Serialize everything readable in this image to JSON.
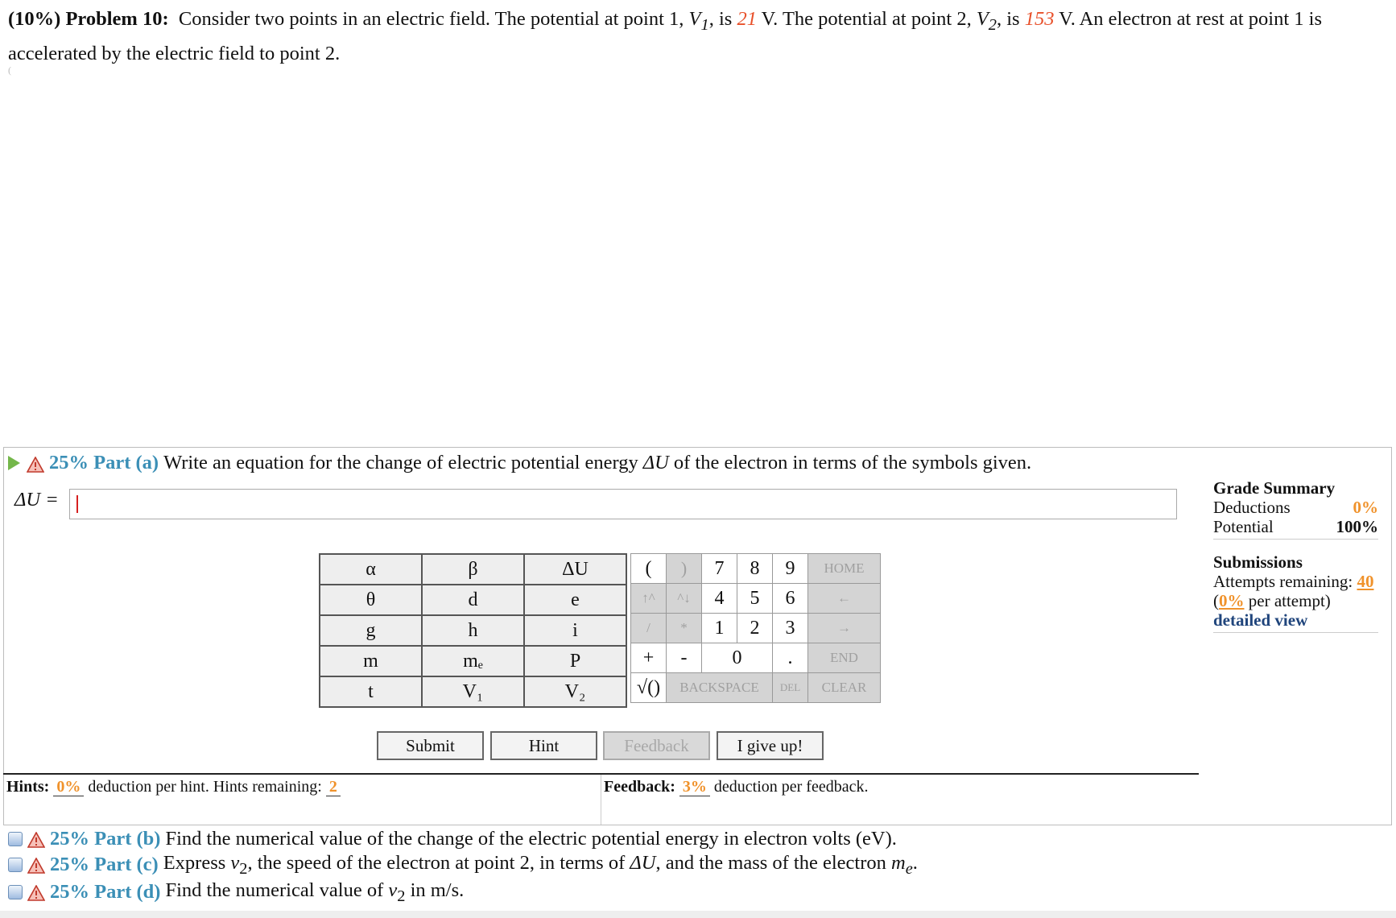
{
  "problem": {
    "weight": "(10%)",
    "title": "Problem 10:",
    "text1": "Consider two points in an electric field. The potential at point 1,",
    "v1_sym": "V",
    "v1_sub": "1",
    "is1": ", is",
    "v1_val": "21",
    "text2": "V. The potential at point 2,",
    "v2_sym": "V",
    "v2_sub": "2",
    "is2": ", is",
    "v2_val": "153",
    "text3": "V. An electron at rest at point 1 is accelerated by the electric field to point 2."
  },
  "part_a": {
    "pct": "25% Part (a)",
    "text": "Write an equation for the change of electric potential energy",
    "sym": "ΔU",
    "text2": "of the electron in terms of the symbols given.",
    "answer_label": "ΔU =",
    "answer_value": ""
  },
  "grade": {
    "title": "Grade Summary",
    "deductions_label": "Deductions",
    "deductions_value": "0%",
    "potential_label": "Potential",
    "potential_value": "100%",
    "submissions_title": "Submissions",
    "attempts_label": "Attempts remaining:",
    "attempts_value": "40",
    "per_attempt_open": "(",
    "per_attempt_value": "0%",
    "per_attempt_close": "per attempt)",
    "detailed": "detailed view"
  },
  "symbols": [
    [
      "α",
      "β",
      "ΔU"
    ],
    [
      "θ",
      "d",
      "e"
    ],
    [
      "g",
      "h",
      "i"
    ],
    [
      "m",
      "mₑ",
      "P"
    ],
    [
      "t",
      "V₁",
      "V₂"
    ]
  ],
  "keypad": {
    "open_paren": "(",
    "close_paren": ")",
    "k7": "7",
    "k8": "8",
    "k9": "9",
    "home": "HOME",
    "up_caret": "↑^",
    "down_caret": "^↓",
    "k4": "4",
    "k5": "5",
    "k6": "6",
    "left": "←",
    "divide": "/",
    "multiply": "*",
    "k1": "1",
    "k2": "2",
    "k3": "3",
    "right": "→",
    "plus": "+",
    "minus": "-",
    "k0": "0",
    "dot": ".",
    "end": "END",
    "sqrt": "√()",
    "backspace": "BACKSPACE",
    "del": "DEL",
    "clear": "CLEAR"
  },
  "buttons": {
    "submit": "Submit",
    "hint": "Hint",
    "feedback": "Feedback",
    "giveup": "I give up!"
  },
  "hints": {
    "label": "Hints:",
    "pct": "0%",
    "text": "deduction per hint. Hints remaining:",
    "remaining": "2"
  },
  "feedback": {
    "label": "Feedback:",
    "pct": "3%",
    "text": "deduction per feedback."
  },
  "part_b": {
    "pct": "25% Part (b)",
    "text": "Find the numerical value of the change of the electric potential energy in electron volts (eV)."
  },
  "part_c": {
    "pct": "25% Part (c)",
    "text_a": "Express",
    "v2_sym": "v",
    "v2_sub": "2",
    "text_b": ", the speed of the electron at point 2, in terms of",
    "sym": "ΔU",
    "text_c": ", and the mass of the electron",
    "me_sym": "m",
    "me_sub": "e",
    "text_d": "."
  },
  "part_d": {
    "pct": "25% Part (d)",
    "text_a": "Find the numerical value of",
    "v2_sym": "v",
    "v2_sub": "2",
    "text_b": "in m/s."
  },
  "colors": {
    "value_red": "#e8502a",
    "part_blue": "#3b8fb6",
    "orange": "#f0922b",
    "link_navy": "#20457c",
    "play_green": "#74b74a"
  }
}
